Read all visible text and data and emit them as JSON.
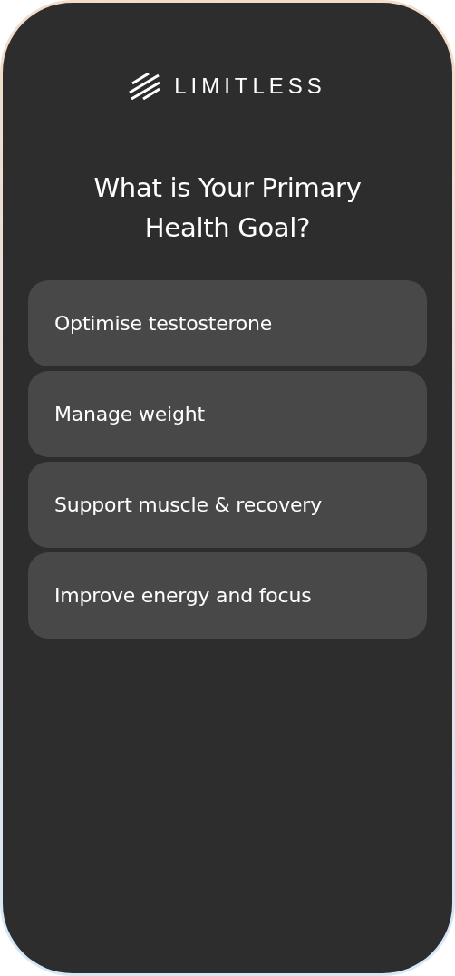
{
  "logo": {
    "text": "LIMITLESS"
  },
  "question": "What is Your Primary Health Goal?",
  "options": [
    {
      "label": "Optimise testosterone"
    },
    {
      "label": "Manage weight"
    },
    {
      "label": "Support muscle & recovery"
    },
    {
      "label": "Improve energy and focus"
    }
  ]
}
